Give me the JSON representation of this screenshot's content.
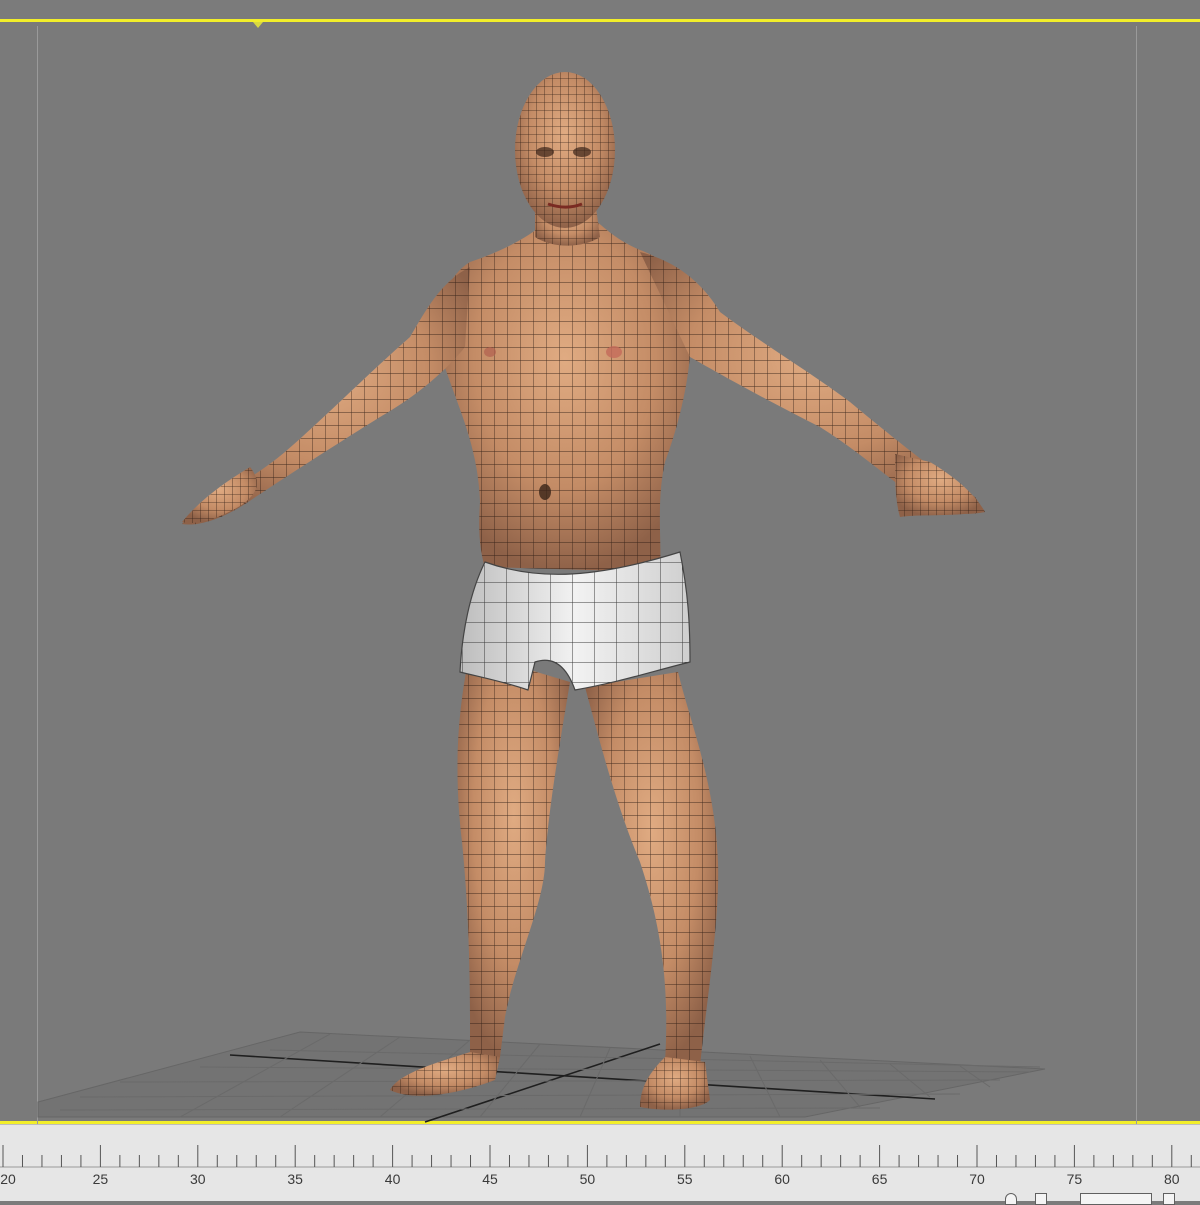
{
  "viewport": {
    "border_color": "#f2ee2a",
    "background": "#7a7a7a",
    "subject": "male-character-base-mesh",
    "shading": "wireframe-over-skin",
    "skin_color": "#c9956e",
    "underwear_color": "#e8e8e8"
  },
  "timeline": {
    "ticks": [
      "20",
      "25",
      "30",
      "35",
      "40",
      "45",
      "50",
      "55",
      "60",
      "65",
      "70",
      "75",
      "80"
    ]
  }
}
